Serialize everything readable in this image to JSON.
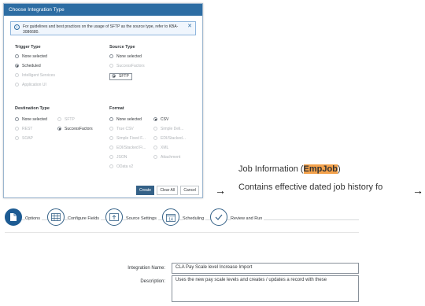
{
  "dialog": {
    "title": "Choose Integration Type",
    "info": "For guidelines and best practices on the usage of SFTP as the source type, refer to KBA-3086680.",
    "trigger_type": {
      "heading": "Trigger Type",
      "options": [
        {
          "label": "None selected",
          "state": "off"
        },
        {
          "label": "Scheduled",
          "state": "on"
        },
        {
          "label": "Intelligent Services",
          "state": "disabled"
        },
        {
          "label": "Application UI",
          "state": "disabled"
        }
      ]
    },
    "source_type": {
      "heading": "Source Type",
      "options": [
        {
          "label": "None selected",
          "state": "off"
        },
        {
          "label": "SuccessFactors",
          "state": "disabled"
        },
        {
          "label": "SFTP",
          "state": "on"
        }
      ]
    },
    "destination_type": {
      "heading": "Destination Type",
      "options": [
        {
          "label": "None selected",
          "state": "off"
        },
        {
          "label": "SFTP",
          "state": "disabled"
        },
        {
          "label": "REST",
          "state": "disabled"
        },
        {
          "label": "SuccessFactors",
          "state": "on"
        },
        {
          "label": "SOAP",
          "state": "disabled"
        }
      ]
    },
    "format": {
      "heading": "Format",
      "options": [
        {
          "label": "None selected",
          "state": "off"
        },
        {
          "label": "CSV",
          "state": "on"
        },
        {
          "label": "True CSV",
          "state": "disabled"
        },
        {
          "label": "Simple Deli...",
          "state": "disabled"
        },
        {
          "label": "Simple Fixed F...",
          "state": "disabled"
        },
        {
          "label": "EDI/Stacked...",
          "state": "disabled"
        },
        {
          "label": "EDI/Stacked Fi...",
          "state": "disabled"
        },
        {
          "label": "XML",
          "state": "disabled"
        },
        {
          "label": "JSON",
          "state": "disabled"
        },
        {
          "label": "Attachment",
          "state": "disabled"
        },
        {
          "label": "OData v2",
          "state": "disabled"
        }
      ]
    },
    "buttons": {
      "create": "Create",
      "clear": "Clear All",
      "cancel": "Cancel"
    }
  },
  "annotation": {
    "arrow": "→",
    "title_prefix": "Job Information (",
    "title_highlight": "EmpJob",
    "title_suffix": ")",
    "description": "Contains effective dated job history fo"
  },
  "steps": [
    {
      "label": "Options",
      "icon": "document-icon",
      "active": true
    },
    {
      "label": "Configure Fields",
      "icon": "table-grid-icon",
      "active": false
    },
    {
      "label": "Source Settings",
      "icon": "upload-icon",
      "active": false
    },
    {
      "label": "Scheduling",
      "icon": "calendar-icon",
      "calendar_day": "14",
      "active": false
    },
    {
      "label": "Review and Run",
      "icon": "checkmark-icon",
      "active": false
    }
  ],
  "form": {
    "integration_name_label": "Integration Name:",
    "integration_name_value": "CLA Pay Scale level Increase Import",
    "description_label": "Description:",
    "description_value": "Uses the new pay scale levels and creates / updates a record with these"
  }
}
